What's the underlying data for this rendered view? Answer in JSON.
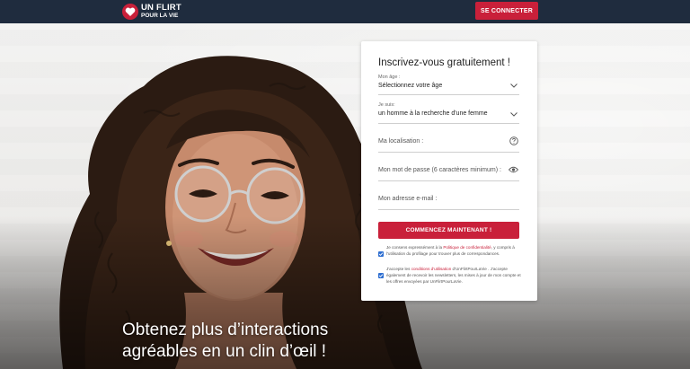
{
  "header": {
    "logo_line1": "UN FLIRT",
    "logo_line2": "POUR LA VIE",
    "login_button": "SE CONNECTER"
  },
  "hero": {
    "tagline_line1": "Obtenez plus d’interactions",
    "tagline_line2": "agréables en un clin d’œil !"
  },
  "form": {
    "title": "Inscrivez-vous gratuitement !",
    "age": {
      "label": "Mon âge :",
      "value": "Sélectionnez votre âge"
    },
    "seeking": {
      "label": "Je suis:",
      "value": "un homme à la recherche d'une femme"
    },
    "location": {
      "placeholder": "Ma localisation :"
    },
    "password": {
      "placeholder": "Mon mot de passe (6 caractères minimum) :"
    },
    "email": {
      "placeholder": "Mon adresse e-mail :"
    },
    "submit": "COMMENCEZ MAINTENANT !",
    "consent1": {
      "before": "Je consens expressément à la ",
      "link": "Politique de confidentialité",
      "after": ", y compris à l'utilisation du profilage pour trouver plus de correspondances."
    },
    "consent2": {
      "before": "J'accepte les ",
      "link": "conditions d'utilisation",
      "after": " d'UnFlirtPourLaVie . J'accepte également de recevoir les newsletters, les mises à jour de mon compte et les offres envoyées par UnFlirtPourLaVie."
    }
  },
  "colors": {
    "brand_red": "#c9203a",
    "header_navy": "#1f2c3e",
    "checkbox_blue": "#2f6fd1"
  },
  "icons": {
    "logo": "heart-icon",
    "select": "chevron-down-icon",
    "location_help": "question-icon",
    "password_toggle": "eye-icon",
    "consent": "checkbox-checked-icon"
  }
}
